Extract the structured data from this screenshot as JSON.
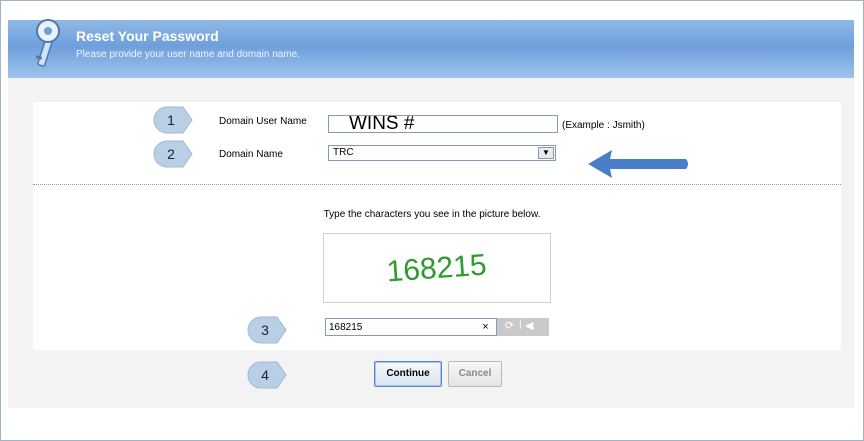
{
  "header": {
    "title": "Reset Your Password",
    "subtitle": "Please provide your user name and domain name."
  },
  "form": {
    "user_label": "Domain User Name",
    "user_value": "WINS #",
    "example": "(Example : Jsmith)",
    "domain_label": "Domain Name",
    "domain_value": "TRC"
  },
  "captcha": {
    "instruction": "Type the characters you see in the picture below.",
    "image_text": "168215",
    "input_value": "168215",
    "clear_symbol": "×"
  },
  "buttons": {
    "continue": "Continue",
    "cancel": "Cancel"
  },
  "callouts": [
    "1",
    "2",
    "3",
    "4"
  ],
  "colors": {
    "header": "#6f9fdb",
    "callout": "#b9cfe6",
    "arrow": "#4a7fc8",
    "captcha_text": "#2f9a2f"
  }
}
